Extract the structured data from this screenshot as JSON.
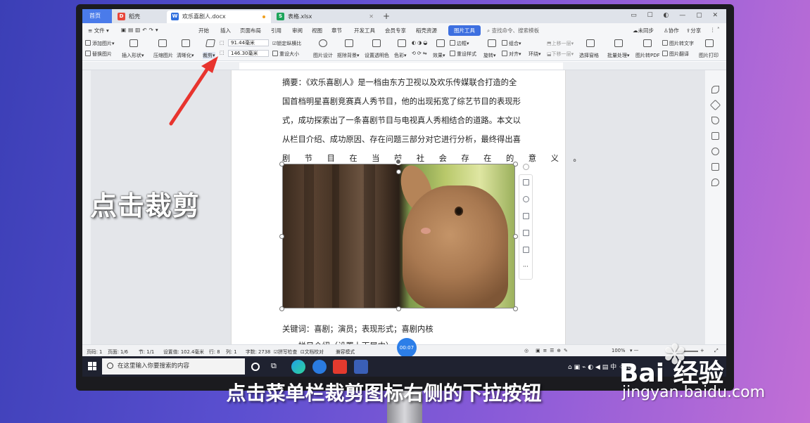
{
  "tabs": [
    {
      "label": "首页",
      "icon": "home-tab"
    },
    {
      "label": "稻壳",
      "icon": "docer-icon",
      "color": "#e8463a",
      "glyph": "D"
    },
    {
      "label": "欢乐喜剧人.docx",
      "icon": "word-doc-icon",
      "color": "#2f6fde",
      "glyph": "W"
    },
    {
      "label": "表格.xlsx",
      "icon": "excel-doc-icon",
      "color": "#1da45a",
      "glyph": "S"
    }
  ],
  "menu": {
    "file": "文件",
    "items": [
      "开始",
      "插入",
      "页面布局",
      "引用",
      "审阅",
      "视图",
      "章节",
      "开发工具",
      "会员专享",
      "稻壳资源"
    ],
    "active_tool": "图片工具",
    "search_placeholder": "查找命令、搜索模板",
    "right": [
      "未同步",
      "协作",
      "分享"
    ]
  },
  "ribbon": {
    "add_picture": "添加图片",
    "replace_picture": "替换图片",
    "insert_shape": "插入形状",
    "compress": "压缩图片",
    "clarify": "清晰化",
    "crop": "裁剪",
    "width": "91.44毫米",
    "height": "146.30毫米",
    "lock_ratio": "锁定纵横比",
    "reset_size": "重设大小",
    "picture_design": "图片设计",
    "remove_bg": "抠除背景",
    "set_transparent": "设置透明色",
    "color": "色彩",
    "effects": "效果",
    "border": "边框",
    "reset_style": "重设样式",
    "combine": "组合",
    "rotate": "旋转",
    "align": "对齐",
    "wrap": "环绕",
    "bring_forward": "上移一层",
    "send_backward": "下移一层",
    "selection_pane": "选择窗格",
    "batch": "批量处理",
    "to_pdf": "图片转PDF",
    "to_text": "图片转文字",
    "translate": "图片翻译",
    "print": "图片打印"
  },
  "document": {
    "lines": [
      "摘要：《欢乐喜剧人》是一档由东方卫视以及欢乐传媒联合打造的全",
      "国首档明星喜剧竞赛真人秀节目，他的出现拓宽了综艺节目的表现形",
      "式，成功探索出了一条喜剧节目与电视真人秀相结合的道路。本文以",
      "从栏目介绍、成功原因、存在问题三部分对它进行分析，最终得出喜",
      "剧节目在当前社会存在的意义。"
    ],
    "keywords": "关键词：喜剧；演员；表现形式；喜剧内核",
    "section1": "一、栏目介绍（设置上下居中）"
  },
  "status": {
    "page_code": "页码: 1",
    "page": "页面: 1/6",
    "section": "节: 1/1",
    "setting": "设置值: 102.4毫米",
    "row": "行: 8",
    "col": "列: 1",
    "words": "字数: 2738",
    "spell": "拼写检查",
    "proof": "文档校对",
    "compat": "兼容模式",
    "zoom": "100%"
  },
  "timer": "00:07",
  "taskbar": {
    "search_placeholder": "在这里输入你要搜索的内容",
    "tray": "中 ⁘ 简"
  },
  "overlay": {
    "left_caption": "点击裁剪",
    "subtitle": "点击菜单栏裁剪图标右侧的下拉按钮",
    "arrow_color": "#e8342e"
  },
  "watermark": {
    "brand": "Bai 经验",
    "url": "jingyan.baidu.com"
  }
}
